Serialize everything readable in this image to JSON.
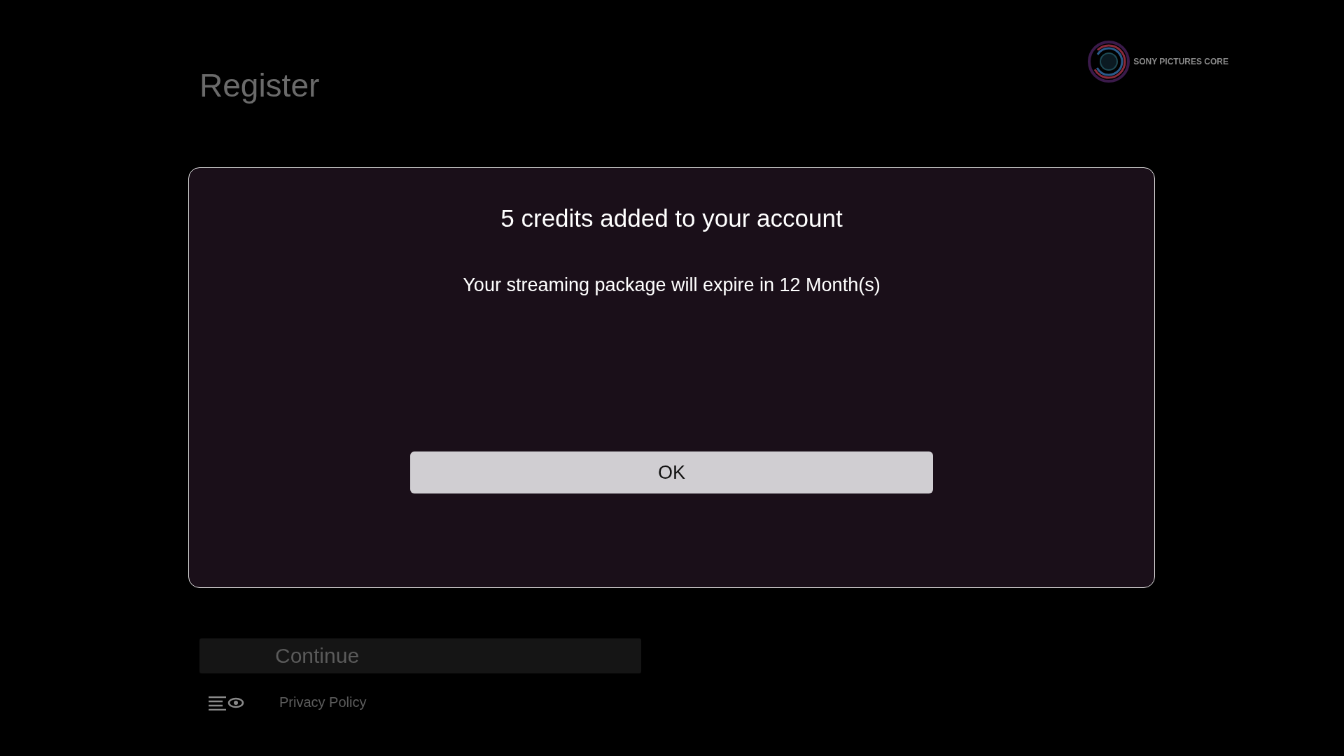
{
  "page": {
    "title": "Register",
    "brand": "SONY PICTURES CORE"
  },
  "dialog": {
    "title": "5 credits added to your account",
    "message": "Your streaming package will expire in 12 Month(s)",
    "button": "OK"
  },
  "continue_button": "Continue",
  "privacy_link": "Privacy Policy"
}
